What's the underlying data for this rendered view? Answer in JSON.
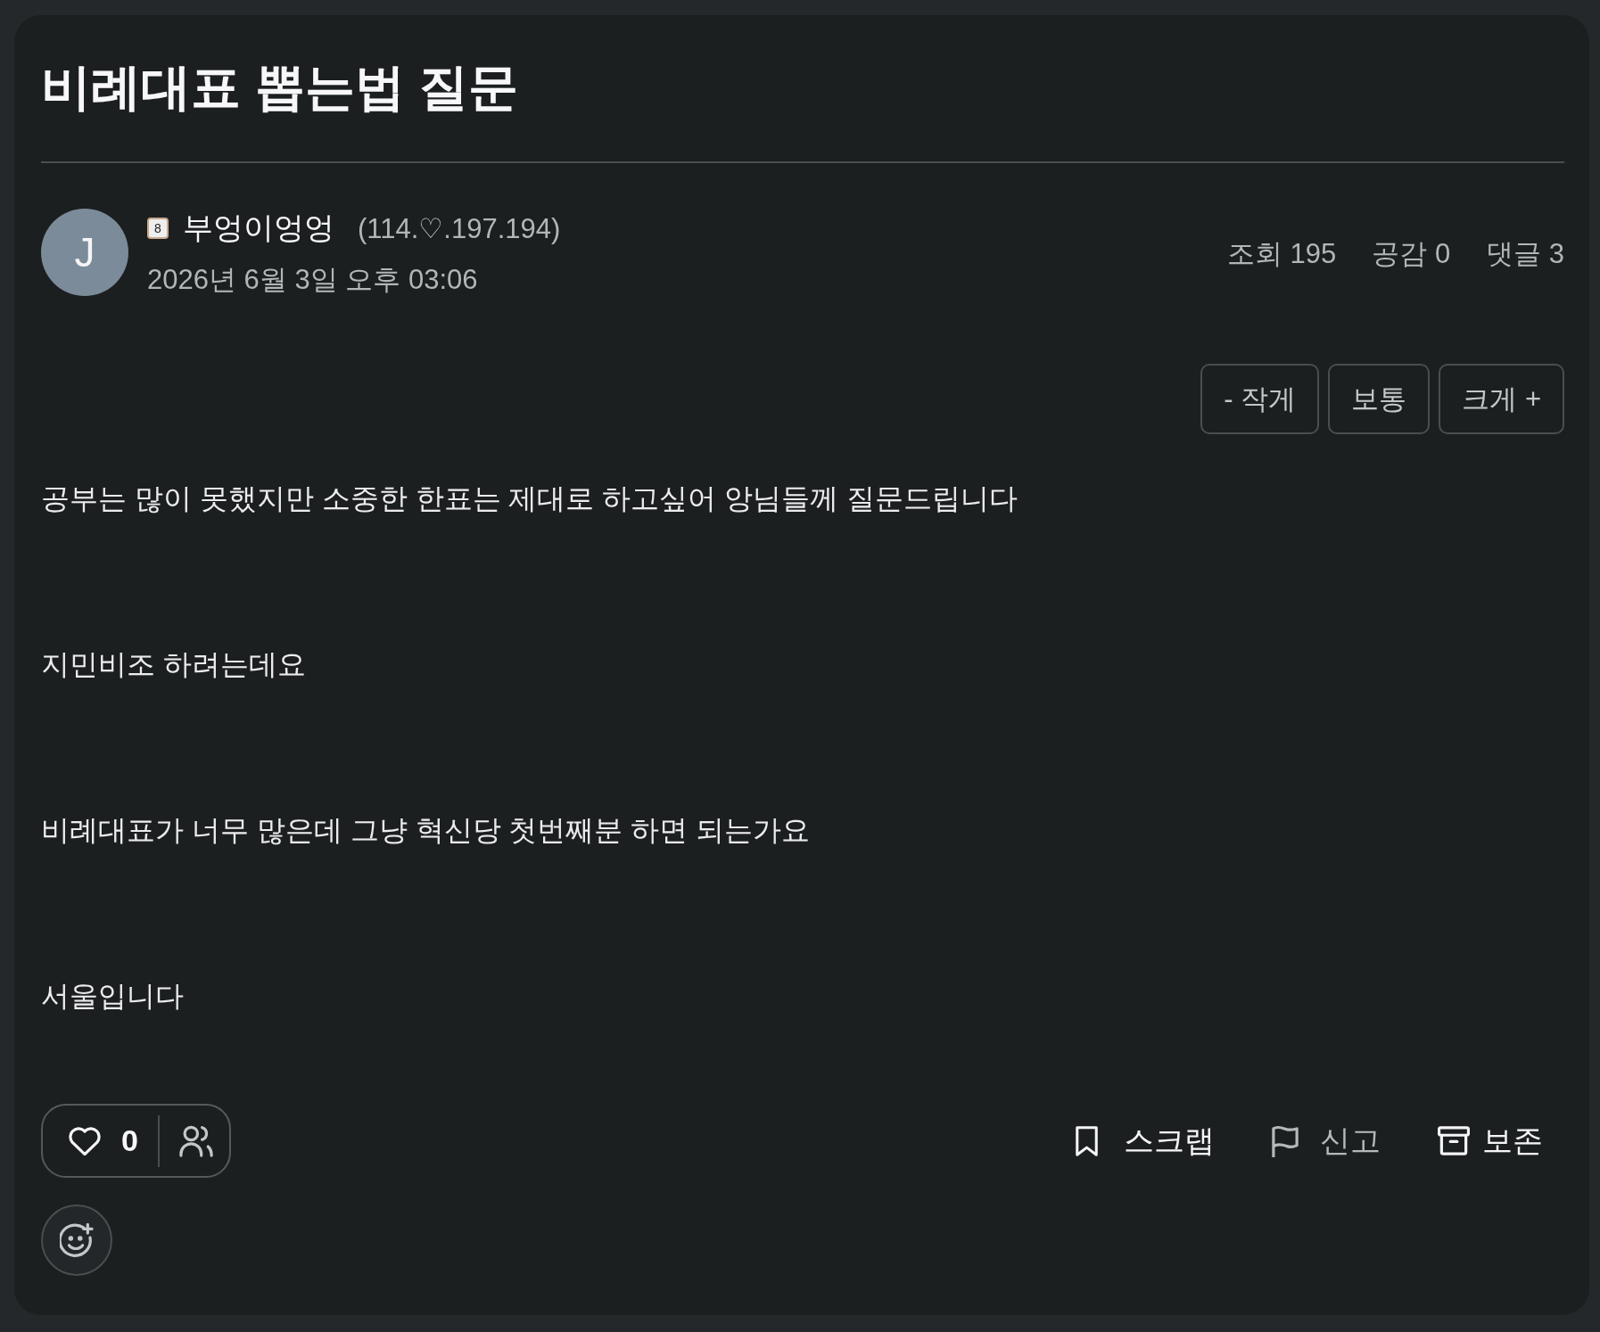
{
  "post": {
    "title": "비례대표 뽑는법 질문"
  },
  "author": {
    "avatar_letter": "J",
    "level_badge": "8",
    "name": "부엉이엉엉",
    "ip": "(114.♡.197.194)",
    "date": "2026년 6월 3일 오후 03:06"
  },
  "stats": [
    "조회 195",
    "공감 0",
    "댓글 3"
  ],
  "font_size_buttons": [
    {
      "label": "- 작게",
      "selected": false
    },
    {
      "label": "보통",
      "selected": false
    },
    {
      "label": "크게 +",
      "selected": false
    }
  ],
  "body": [
    "공부는 많이 못했지만 소중한 한표는 제대로 하고싶어 앙님들께 질문드립니다",
    "지민비조 하려는데요",
    "비례대표가 너무 많은데 그냥 혁신당 첫번째분 하면 되는가요",
    "서울입니다"
  ],
  "reactions": {
    "like_count": "0",
    "liked": false
  },
  "actions": [
    {
      "kind": "scrap",
      "label": "스크랩"
    },
    {
      "kind": "report",
      "label": "신고"
    },
    {
      "kind": "archive",
      "label": "보존"
    }
  ]
}
